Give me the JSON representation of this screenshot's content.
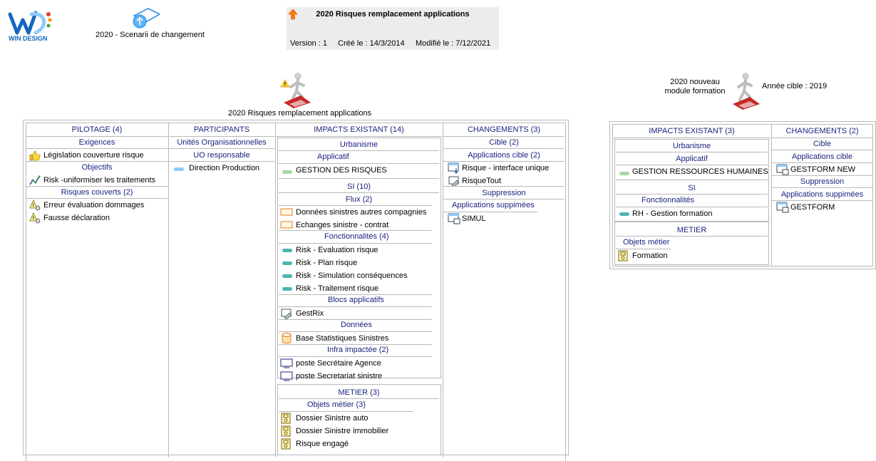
{
  "logo": {
    "brand": "WIN DESIGN"
  },
  "scenario": {
    "label": "2020 - Scenarii de changement"
  },
  "header": {
    "title": "2020 Risques remplacement applications",
    "version": "Version : 1",
    "created": "Créé le : 14/3/2014",
    "modified": "Modifié le : 7/12/2021"
  },
  "left_card": {
    "title": "2020 Risques remplacement applications",
    "pilotage": {
      "header": "PILOTAGE (4)",
      "exigences": "Exigences",
      "exigence_item": "Législation couverture risque",
      "objectifs": "Objectifs",
      "objectif_item": "Risk -uniformiser les traitements",
      "risques": "Risques couverts (2)",
      "risque_items": [
        "Erreur évaluation dommages",
        "Fausse déclaration"
      ]
    },
    "participants": {
      "header": "PARTICIPANTS",
      "unites": "Unités Organisationnelles",
      "uo": "UO responsable",
      "uo_item": "Direction Production"
    },
    "impacts": {
      "header": "IMPACTS EXISTANT (14)",
      "urbanisme": "Urbanisme",
      "applicatif": "Applicatif",
      "applicatif_item": "GESTION DES RISQUES",
      "si": "SI (10)",
      "flux": "Flux (2)",
      "flux_items": [
        "Données sinistres autres compagnies",
        "Echanges sinistre - contrat"
      ],
      "fonctionnalites": "Fonctionnalités (4)",
      "fonct_items": [
        "Risk - Evaluation risque",
        "Risk - Plan risque",
        "Risk - Simulation conséquences",
        "Risk - Traitement risque"
      ],
      "blocs": "Blocs applicatifs",
      "bloc_item": "GestRix",
      "donnees": "Données",
      "donnee_item": "Base Statistiques Sinistres",
      "infra": "Infra impactée (2)",
      "infra_items": [
        "poste Secrétaire Agence",
        "poste Secretariat sinistre"
      ],
      "metier": "METIER (3)",
      "objets": "Objets métier (3)",
      "objet_items": [
        "Dossier Sinistre auto",
        "Dossier Sinistre immobilier",
        "Risque engagé"
      ]
    },
    "changements": {
      "header": "CHANGEMENTS (3)",
      "cible": "Cible (2)",
      "app_cible": "Applications cible (2)",
      "cible_items": [
        "Risque - interface unique",
        "RisqueTout"
      ],
      "suppression": "Suppression",
      "app_supp": "Applications suppimées",
      "supp_item": "SIMUL"
    }
  },
  "right_card": {
    "title_line1": "2020 nouveau",
    "title_line2": "module formation",
    "annee": "Année cible : 2019",
    "impacts": {
      "header": "IMPACTS EXISTANT (3)",
      "urbanisme": "Urbanisme",
      "applicatif": "Applicatif",
      "applicatif_item": "GESTION RESSOURCES HUMAINES",
      "si": "SI",
      "fonctionnalites": "Fonctionnalités",
      "fonct_item": "RH - Gestion formation",
      "metier": "METIER",
      "objets": "Objets métier",
      "objet_item": "Formation"
    },
    "changements": {
      "header": "CHANGEMENTS (2)",
      "cible": "Cible",
      "app_cible": "Applications cible",
      "cible_item": "GESTFORM NEW",
      "suppression": "Suppression",
      "app_supp": "Applications suppimées",
      "supp_item": "GESTFORM"
    }
  },
  "colors": {
    "navy": "#1a237e",
    "teal": "#4db6ac",
    "lightgreen": "#a5d6a7",
    "blueblock": "#90caf9",
    "orange": "#e67e22"
  }
}
